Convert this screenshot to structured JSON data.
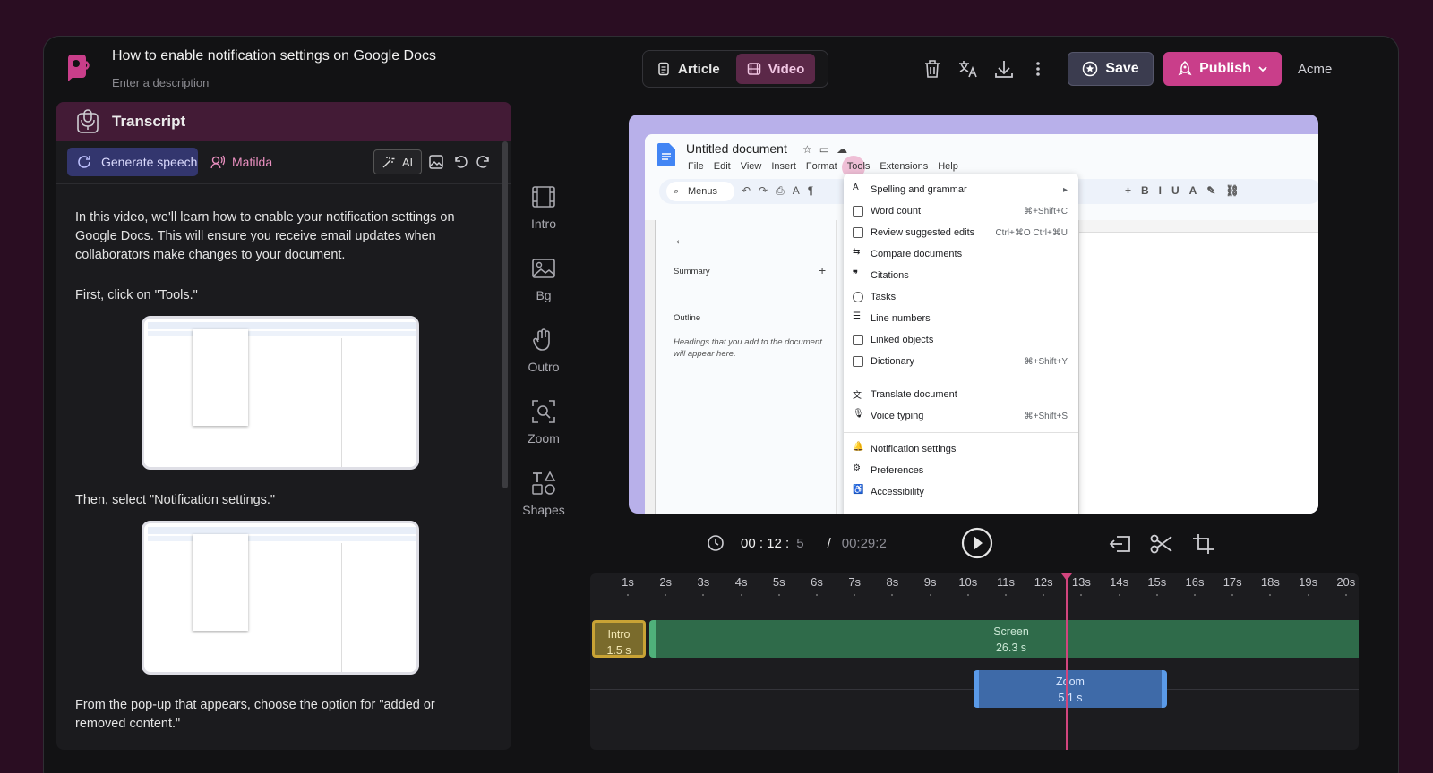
{
  "header": {
    "title": "How to enable notification settings on Google Docs",
    "description_placeholder": "Enter a description",
    "tabs": [
      {
        "label": "Article"
      },
      {
        "label": "Video"
      }
    ],
    "save_label": "Save",
    "publish_label": "Publish",
    "workspace": "Acme"
  },
  "transcript": {
    "title": "Transcript",
    "generate_label": "Generate speech",
    "voice": "Matilda",
    "ai_label": "AI",
    "paragraphs": [
      "In this video, we'll learn how to enable your notification settings on Google Docs. This will ensure you receive email updates when collaborators make changes to your document.",
      "First, click on \"Tools.\"",
      "Then, select \"Notification settings.\"",
      "From the pop-up that appears, choose the option for \"added or removed content.\""
    ]
  },
  "rail": [
    {
      "label": "Intro",
      "icon": "film-icon"
    },
    {
      "label": "Bg",
      "icon": "image-icon"
    },
    {
      "label": "Outro",
      "icon": "hand-wave-icon"
    },
    {
      "label": "Zoom",
      "icon": "zoom-icon"
    },
    {
      "label": "Shapes",
      "icon": "shapes-icon"
    }
  ],
  "preview": {
    "doc_title": "Untitled document",
    "menubar": [
      "File",
      "Edit",
      "View",
      "Insert",
      "Format",
      "Tools",
      "Extensions",
      "Help"
    ],
    "search": "Menus",
    "summary": "Summary",
    "outline": "Outline",
    "outline_hint": "Headings that you add to the document will appear here.",
    "menu_items": [
      {
        "label": "Spelling and grammar",
        "shortcut": "▸"
      },
      {
        "label": "Word count",
        "shortcut": "⌘+Shift+C"
      },
      {
        "label": "Review suggested edits",
        "shortcut": "Ctrl+⌘O Ctrl+⌘U"
      },
      {
        "label": "Compare documents",
        "shortcut": ""
      },
      {
        "label": "Citations",
        "shortcut": ""
      },
      {
        "label": "Tasks",
        "shortcut": ""
      },
      {
        "label": "Line numbers",
        "shortcut": ""
      },
      {
        "label": "Linked objects",
        "shortcut": ""
      },
      {
        "label": "Dictionary",
        "shortcut": "⌘+Shift+Y"
      },
      {
        "label": "Translate document",
        "shortcut": ""
      },
      {
        "label": "Voice typing",
        "shortcut": "⌘+Shift+S"
      },
      {
        "label": "Notification settings",
        "shortcut": ""
      },
      {
        "label": "Preferences",
        "shortcut": ""
      },
      {
        "label": "Accessibility",
        "shortcut": ""
      }
    ]
  },
  "playback": {
    "current_main": "00 : 12 :",
    "current_frame": "5",
    "separator": "/",
    "total": "00:29:2"
  },
  "timeline": {
    "ticks": [
      "1s",
      "2s",
      "3s",
      "4s",
      "5s",
      "6s",
      "7s",
      "8s",
      "9s",
      "10s",
      "11s",
      "12s",
      "13s",
      "14s",
      "15s",
      "16s",
      "17s",
      "18s",
      "19s",
      "20s"
    ],
    "clips": [
      {
        "name": "Intro",
        "duration": "1.5 s"
      },
      {
        "name": "Screen",
        "duration": "26.3 s"
      },
      {
        "name": "Zoom",
        "duration": "5.1 s"
      }
    ],
    "playhead_seconds": 12.6
  },
  "colors": {
    "accent": "#c93e8a",
    "video_tab": "#5b2848",
    "intro": "#c9a335",
    "screen": "#2f6b4a",
    "zoom": "#3e6aa8"
  }
}
